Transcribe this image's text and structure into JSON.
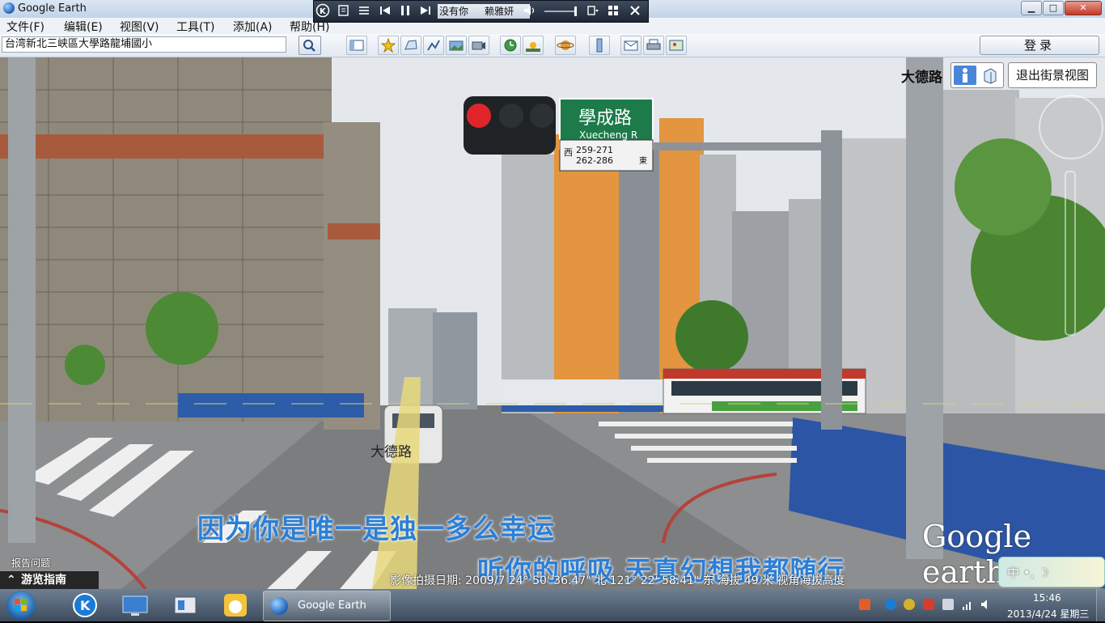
{
  "window": {
    "title": "Google Earth",
    "min_label": "▁",
    "max_label": "□",
    "close_label": "✕"
  },
  "player": {
    "song": "没有你",
    "artist": "赖雅妍",
    "icons": [
      "logo-icon",
      "lyrics-icon",
      "playlist-icon",
      "prev-icon",
      "pause-icon",
      "next-icon",
      "volume-icon",
      "settings-icon",
      "grid-icon",
      "close-icon"
    ]
  },
  "menu": [
    "文件(F)",
    "编辑(E)",
    "视图(V)",
    "工具(T)",
    "添加(A)",
    "帮助(H)"
  ],
  "search": {
    "value": "台湾新北三峡區大學路龍埔國小"
  },
  "toolbar": {
    "signin": "登录",
    "icons": [
      "sidebar-icon",
      "placemark-icon",
      "polygon-icon",
      "path-icon",
      "image-overlay-icon",
      "record-tour-icon",
      "historical-imagery-icon",
      "sunlight-icon",
      "planets-icon",
      "ruler-icon",
      "email-icon",
      "print-icon",
      "view-in-maps-icon"
    ]
  },
  "streetview": {
    "street_name": "大德路",
    "exit_label": "退出街景视图",
    "road_label": "大德路",
    "sign_chinese": "學成路",
    "sign_english": "Xuecheng R",
    "sign_left_num": "259-271",
    "sign_right_num": "262-286",
    "sign_west": "西",
    "sign_east": "東"
  },
  "overlay": {
    "lyric1": "因为你是唯一是独一多么幸运",
    "lyric2": "听你的呼吸  天真幻想我都随行",
    "logo": "Google earth",
    "report": "报告问题",
    "tour_guide": "游览指南",
    "status": "影像拍摄日期: 2009/7   24° 50' 36.47\" 北 121° 22' 58.41\" 东 海拔   49 米   视角海拔高度",
    "ime": "中 •, ☽"
  },
  "taskbar": {
    "active_app": "Google Earth",
    "time": "15:46",
    "date": "2013/4/24 星期三"
  }
}
